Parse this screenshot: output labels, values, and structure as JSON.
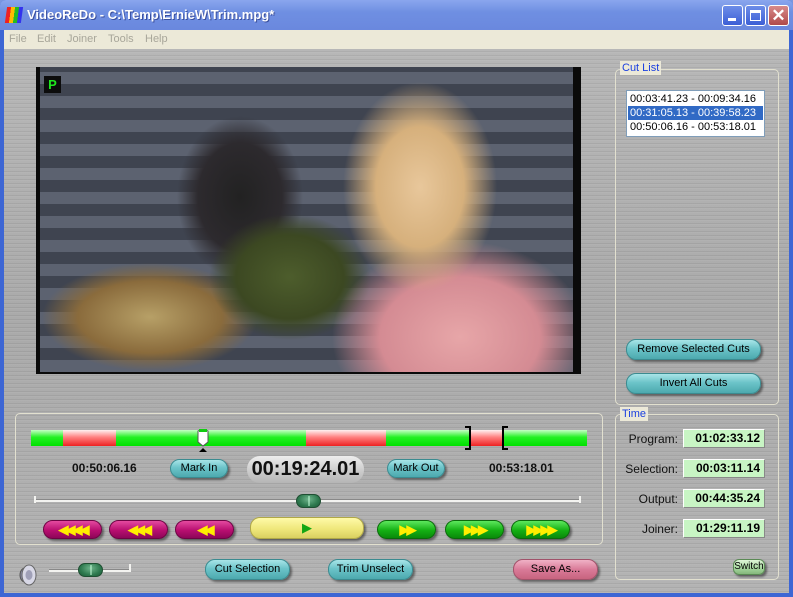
{
  "window": {
    "title": "VideoReDo - C:\\Temp\\ErnieW\\Trim.mpg*",
    "controls": {
      "minimize": "minimize",
      "maximize": "maximize",
      "close": "✕"
    }
  },
  "menu": [
    "File",
    "Edit",
    "Joiner",
    "Tools",
    "Help"
  ],
  "video": {
    "osd_indicator": "P"
  },
  "cut_list": {
    "label": "Cut List",
    "items": [
      {
        "text": "00:03:41.23 - 00:09:34.16",
        "selected": false
      },
      {
        "text": "00:31:05.13 - 00:39:58.23",
        "selected": true
      },
      {
        "text": "00:50:06.16 - 00:53:18.01",
        "selected": false
      }
    ],
    "remove_selected_label": "Remove Selected Cuts",
    "invert_all_label": "Invert All Cuts"
  },
  "timeline": {
    "playhead_fraction": 0.31,
    "segments": [
      {
        "type": "keep",
        "start": 0.0,
        "end": 0.057
      },
      {
        "type": "cut",
        "start": 0.057,
        "end": 0.152
      },
      {
        "type": "keep",
        "start": 0.152,
        "end": 0.495
      },
      {
        "type": "cut",
        "start": 0.495,
        "end": 0.638
      },
      {
        "type": "keep",
        "start": 0.638,
        "end": 0.792
      },
      {
        "type": "cut",
        "start": 0.792,
        "end": 0.848
      },
      {
        "type": "keep",
        "start": 0.848,
        "end": 1.0
      }
    ],
    "selection_start_fraction": 0.792,
    "selection_end_fraction": 0.848,
    "mark_in_time": "00:50:06.16",
    "mark_in_label": "Mark In",
    "current_time": "00:19:24.01",
    "mark_out_label": "Mark Out",
    "mark_out_time": "00:53:18.01",
    "scrub_position_fraction": 0.5
  },
  "transport": {
    "rew4": "◀◀◀◀",
    "rew3": "◀◀◀",
    "rew2": "◀◀",
    "play": "▶",
    "ff2": "▶▶",
    "ff3": "▶▶▶",
    "ff4": "▶▶▶▶"
  },
  "volume": {
    "icon": "speaker-icon",
    "level_fraction": 0.5
  },
  "actions": {
    "cut_selection": "Cut Selection",
    "trim_unselect": "Trim Unselect",
    "save_as": "Save As..."
  },
  "time_panel": {
    "label": "Time",
    "rows": [
      {
        "label": "Program:",
        "value": "01:02:33.12"
      },
      {
        "label": "Selection:",
        "value": "00:03:11.14"
      },
      {
        "label": "Output:",
        "value": "00:44:35.24"
      },
      {
        "label": "Joiner:",
        "value": "01:29:11.19"
      }
    ],
    "switch_label": "Switch"
  }
}
